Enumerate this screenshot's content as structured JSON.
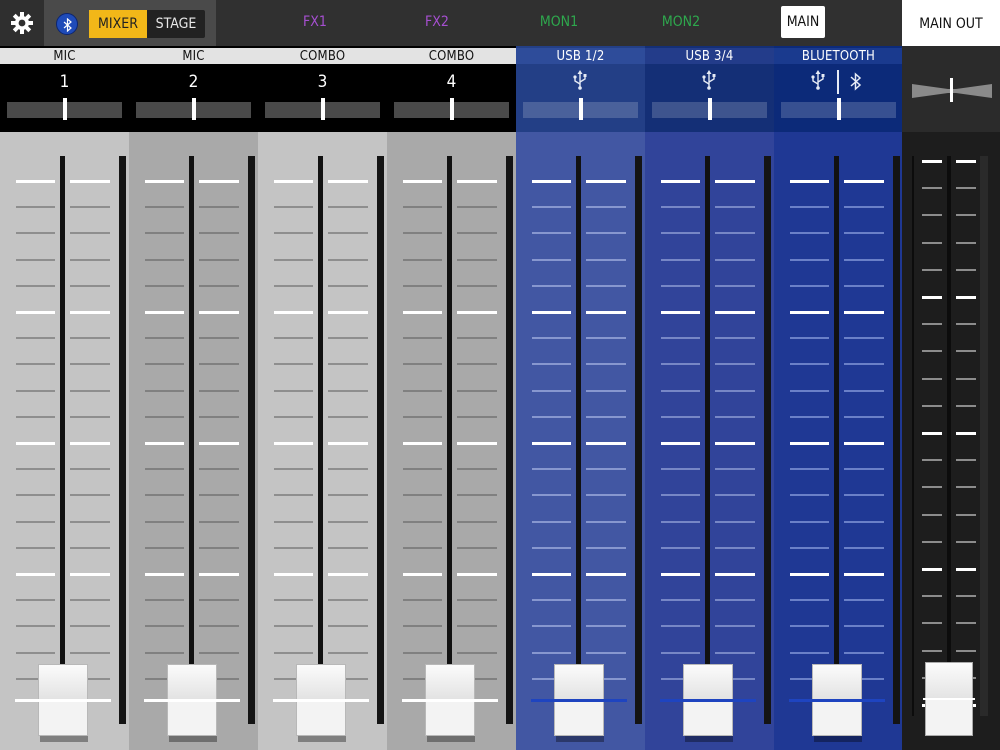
{
  "top_bar": {
    "settings_icon": "gear-icon",
    "bluetooth_icon": "bluetooth-icon",
    "mode_buttons": {
      "mixer": "MIXER",
      "stage": "STAGE",
      "active": "MIXER"
    },
    "sends": [
      {
        "label": "FX1",
        "color": "#a64fd1"
      },
      {
        "label": "FX2",
        "color": "#a64fd1"
      },
      {
        "label": "MON1",
        "color": "#2ea84d"
      },
      {
        "label": "MON2",
        "color": "#2ea84d"
      },
      {
        "label": "MAIN",
        "active": true
      }
    ],
    "main_out_label": "MAIN OUT"
  },
  "colors": {
    "accent_yellow": "#f2b718",
    "fx_purple": "#a64fd1",
    "mon_green": "#2ea84d",
    "gray_channel_light": "#c4c4c4",
    "gray_channel_dark": "#a9a9a9",
    "usb12_blue": "#4257a3",
    "usb34_blue": "#31449a",
    "bluetooth_blue": "#1f3894"
  },
  "channels": [
    {
      "label": "MIC",
      "number": "1",
      "type": "analog"
    },
    {
      "label": "MIC",
      "number": "2",
      "type": "analog"
    },
    {
      "label": "COMBO",
      "number": "3",
      "type": "analog"
    },
    {
      "label": "COMBO",
      "number": "4",
      "type": "analog"
    },
    {
      "label": "USB 1/2",
      "icon": "usb-icon",
      "type": "usb"
    },
    {
      "label": "USB 3/4",
      "icon": "usb-icon",
      "type": "usb"
    },
    {
      "label": "BLUETOOTH",
      "icons": [
        "usb-icon",
        "bluetooth-icon"
      ],
      "type": "bluetooth"
    }
  ],
  "main_out": {
    "label": "MAIN OUT"
  }
}
